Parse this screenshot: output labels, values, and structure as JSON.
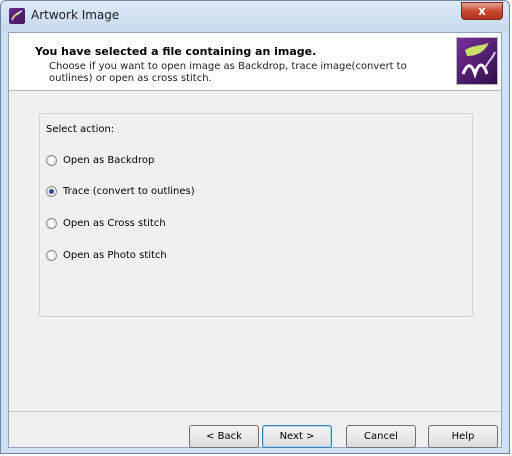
{
  "window": {
    "title": "Artwork Image",
    "close_glyph": "x"
  },
  "header": {
    "title": "You have selected a file containing an image.",
    "description": "Choose if you want to open image as Backdrop, trace image(convert to outlines) or open as cross stitch."
  },
  "group": {
    "label": "Select action:"
  },
  "options": [
    {
      "label": "Open as Backdrop",
      "checked": false
    },
    {
      "label": "Trace (convert to outlines)",
      "checked": true
    },
    {
      "label": "Open as Cross stitch",
      "checked": false
    },
    {
      "label": "Open as Photo stitch",
      "checked": false
    }
  ],
  "buttons": {
    "back": "< Back",
    "next": "Next >",
    "cancel": "Cancel",
    "help": "Help"
  },
  "colors": {
    "accent": "#2b4c9b",
    "logo": "#5a2080"
  },
  "icons": {
    "app": "artwork-app-icon",
    "logo": "leaf-logo-icon"
  }
}
